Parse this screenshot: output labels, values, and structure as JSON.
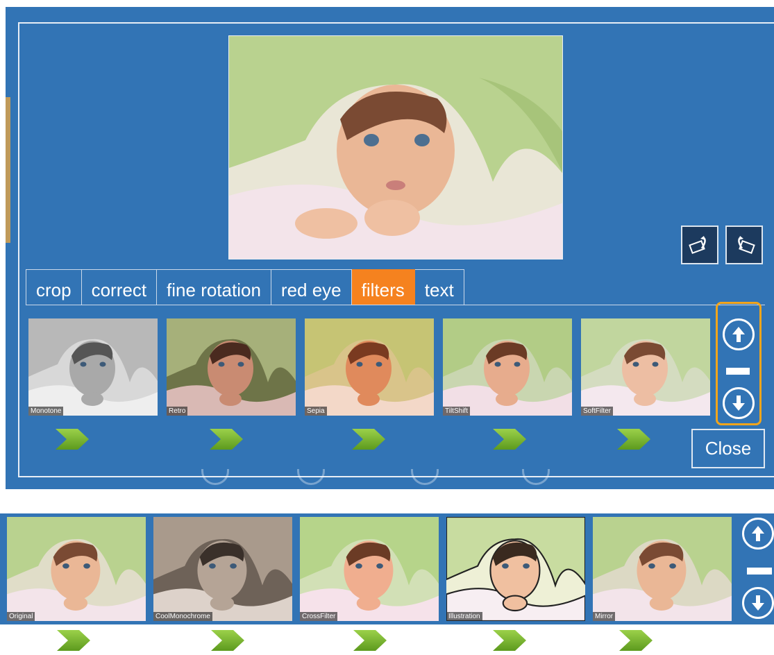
{
  "editor": {
    "tabs": [
      {
        "label": "crop",
        "active": false
      },
      {
        "label": "correct",
        "active": false
      },
      {
        "label": "fine rotation",
        "active": false
      },
      {
        "label": "red eye",
        "active": false
      },
      {
        "label": "filters",
        "active": true
      },
      {
        "label": "text",
        "active": false
      }
    ],
    "rotate_left_icon": "rotate-left-icon",
    "rotate_right_icon": "rotate-right-icon",
    "close_label": "Close",
    "filters_top": [
      "Monotone",
      "Retro",
      "Sepia",
      "TiltShift",
      "SoftFilter"
    ],
    "filters_bottom": [
      "Original",
      "CoolMonochrome",
      "CrossFilter",
      "Illustration",
      "Mirror"
    ]
  },
  "colors": {
    "panel_blue": "#3274b5",
    "active_tab": "#f5821f",
    "highlight": "#f3a51b",
    "arrow_green": "#7cb82f"
  }
}
